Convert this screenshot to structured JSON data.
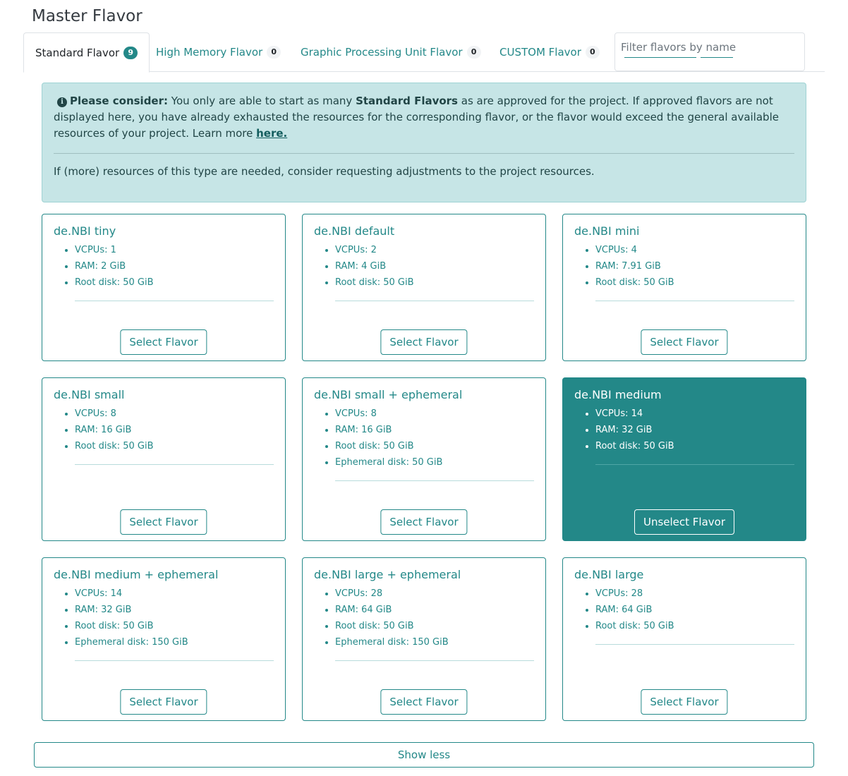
{
  "page_title": "Master Flavor",
  "tabs": [
    {
      "label": "Standard Flavor",
      "count": "9",
      "active": true
    },
    {
      "label": "High Memory Flavor",
      "count": "0",
      "active": false
    },
    {
      "label": "Graphic Processing Unit Flavor",
      "count": "0",
      "active": false
    },
    {
      "label": "CUSTOM Flavor",
      "count": "0",
      "active": false
    }
  ],
  "filter": {
    "placeholder": "Filter flavors by name",
    "value": ""
  },
  "alert": {
    "icon": "info-circle-icon",
    "prefix": "Please consider:",
    "text_1": " You only are able to start as many ",
    "bold": "Standard Flavors",
    "text_2": " as are approved for the project. If approved flavors are not displayed here, you have already exhausted the resources for the corresponding flavor, or the flavor would exceed the general available resources of your project. Learn more ",
    "link": "here.",
    "footer": "If (more) resources of this type are needed, consider requesting adjustments to the project resources."
  },
  "flavors": [
    {
      "name": "de.NBI tiny",
      "specs": [
        "VCPUs: 1",
        "RAM: 2 GiB",
        "Root disk: 50 GiB"
      ],
      "button": "Select Flavor",
      "selected": false
    },
    {
      "name": "de.NBI default",
      "specs": [
        "VCPUs: 2",
        "RAM: 4 GiB",
        "Root disk: 50 GiB"
      ],
      "button": "Select Flavor",
      "selected": false
    },
    {
      "name": "de.NBI mini",
      "specs": [
        "VCPUs: 4",
        "RAM: 7.91 GiB",
        "Root disk: 50 GiB"
      ],
      "button": "Select Flavor",
      "selected": false
    },
    {
      "name": "de.NBI small",
      "specs": [
        "VCPUs: 8",
        "RAM: 16 GiB",
        "Root disk: 50 GiB"
      ],
      "button": "Select Flavor",
      "selected": false
    },
    {
      "name": "de.NBI small + ephemeral",
      "specs": [
        "VCPUs: 8",
        "RAM: 16 GiB",
        "Root disk: 50 GiB",
        "Ephemeral disk: 50 GiB"
      ],
      "button": "Select Flavor",
      "selected": false
    },
    {
      "name": "de.NBI medium",
      "specs": [
        "VCPUs: 14",
        "RAM: 32 GiB",
        "Root disk: 50 GiB"
      ],
      "button": "Unselect Flavor",
      "selected": true
    },
    {
      "name": "de.NBI medium + ephemeral",
      "specs": [
        "VCPUs: 14",
        "RAM: 32 GiB",
        "Root disk: 50 GiB",
        "Ephemeral disk: 150 GiB"
      ],
      "button": "Select Flavor",
      "selected": false
    },
    {
      "name": "de.NBI large + ephemeral",
      "specs": [
        "VCPUs: 28",
        "RAM: 64 GiB",
        "Root disk: 50 GiB",
        "Ephemeral disk: 150 GiB"
      ],
      "button": "Select Flavor",
      "selected": false
    },
    {
      "name": "de.NBI large",
      "specs": [
        "VCPUs: 28",
        "RAM: 64 GiB",
        "Root disk: 50 GiB"
      ],
      "button": "Select Flavor",
      "selected": false
    }
  ],
  "show_less_label": "Show less",
  "colors": {
    "accent": "#238888",
    "alert_bg": "#c6e5e6",
    "alert_text": "#214546"
  }
}
